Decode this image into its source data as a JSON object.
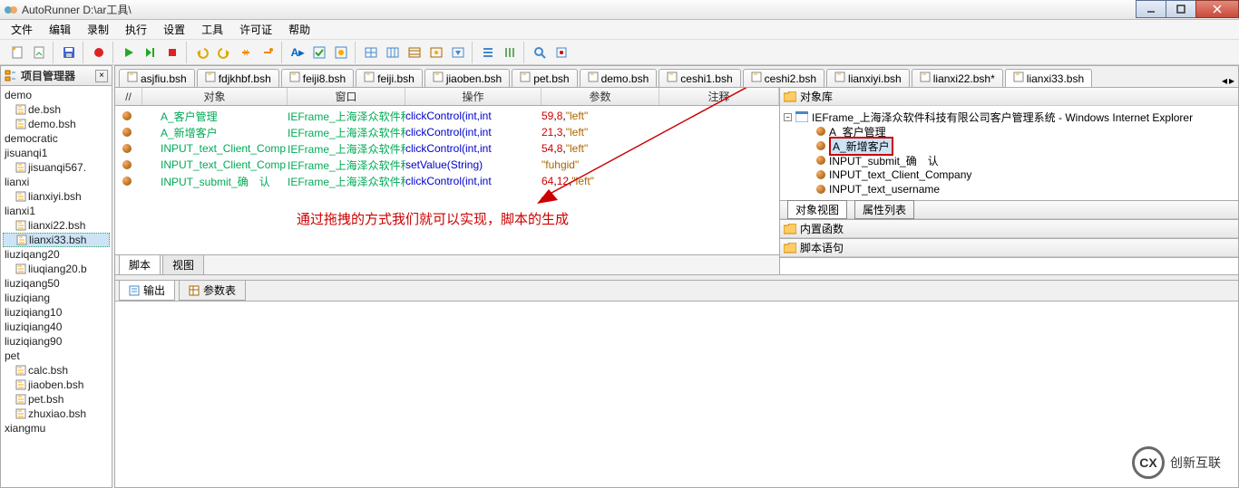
{
  "title": "AutoRunner  D:\\ar工具\\",
  "menu": [
    "文件",
    "编辑",
    "录制",
    "执行",
    "设置",
    "工具",
    "许可证",
    "帮助"
  ],
  "left_panel": {
    "title": "项目管理器",
    "items": [
      {
        "label": "demo",
        "indent": false,
        "icon": false
      },
      {
        "label": "de.bsh",
        "indent": true,
        "icon": true
      },
      {
        "label": "demo.bsh",
        "indent": true,
        "icon": true
      },
      {
        "label": "democratic",
        "indent": false,
        "icon": false
      },
      {
        "label": "jisuanqi1",
        "indent": false,
        "icon": false
      },
      {
        "label": "jisuanqi567.",
        "indent": true,
        "icon": true
      },
      {
        "label": "lianxi",
        "indent": false,
        "icon": false
      },
      {
        "label": "lianxiyi.bsh",
        "indent": true,
        "icon": true
      },
      {
        "label": "lianxi1",
        "indent": false,
        "icon": false
      },
      {
        "label": "lianxi22.bsh",
        "indent": true,
        "icon": true
      },
      {
        "label": "lianxi33.bsh",
        "indent": true,
        "icon": true,
        "selected": true
      },
      {
        "label": "liuziqang20",
        "indent": false,
        "icon": false
      },
      {
        "label": "liuqiang20.b",
        "indent": true,
        "icon": true
      },
      {
        "label": "liuziqang50",
        "indent": false,
        "icon": false
      },
      {
        "label": "liuziqiang",
        "indent": false,
        "icon": false
      },
      {
        "label": "liuziqiang10",
        "indent": false,
        "icon": false
      },
      {
        "label": "liuziqiang40",
        "indent": false,
        "icon": false
      },
      {
        "label": "liuziqiang90",
        "indent": false,
        "icon": false
      },
      {
        "label": "pet",
        "indent": false,
        "icon": false
      },
      {
        "label": "calc.bsh",
        "indent": true,
        "icon": true
      },
      {
        "label": "jiaoben.bsh",
        "indent": true,
        "icon": true
      },
      {
        "label": "pet.bsh",
        "indent": true,
        "icon": true
      },
      {
        "label": "zhuxiao.bsh",
        "indent": true,
        "icon": true
      },
      {
        "label": "xiangmu",
        "indent": false,
        "icon": false
      }
    ]
  },
  "file_tabs": [
    "asjfiu.bsh",
    "fdjkhbf.bsh",
    "feiji8.bsh",
    "feiji.bsh",
    "jiaoben.bsh",
    "pet.bsh",
    "demo.bsh",
    "ceshi1.bsh",
    "ceshi2.bsh",
    "lianxiyi.bsh",
    "lianxi22.bsh*",
    "lianxi33.bsh"
  ],
  "active_tab": 11,
  "script_headers": [
    "//",
    "对象",
    "窗口",
    "操作",
    "参数",
    "注释"
  ],
  "script_rows": [
    {
      "obj": "A_客户管理",
      "win": "IEFrame_上海泽众软件科",
      "op": "clickControl(int,int",
      "param_html": "<span class='num'>59</span>,<span class='num'>8</span>,<span class='str'>\"left\"</span>"
    },
    {
      "obj": "A_新增客户",
      "win": "IEFrame_上海泽众软件科",
      "op": "clickControl(int,int",
      "param_html": "<span class='num'>21</span>,<span class='num'>3</span>,<span class='str'>\"left\"</span>"
    },
    {
      "obj": "INPUT_text_Client_Comp",
      "win": "IEFrame_上海泽众软件科",
      "op": "clickControl(int,int",
      "param_html": "<span class='num'>54</span>,<span class='num'>8</span>,<span class='str'>\"left\"</span>"
    },
    {
      "obj": "INPUT_text_Client_Comp",
      "win": "IEFrame_上海泽众软件科",
      "op": "setValue(String)",
      "param_html": "<span class='str'>\"fuhgid\"</span>"
    },
    {
      "obj": "INPUT_submit_确　认",
      "win": "IEFrame_上海泽众软件科",
      "op": "clickControl(int,int",
      "param_html": "<span class='num'>64</span>,<span class='num'>12</span>,<span class='str'>\"left\"</span>"
    }
  ],
  "annotation_text": "通过拖拽的方式我们就可以实现，脚本的生成",
  "sub_tabs": [
    "脚本",
    "视图"
  ],
  "right_panel": {
    "obj_lib": "对象库",
    "root_node": "IEFrame_上海泽众软件科技有限公司客户管理系统 - Windows Internet Explorer",
    "children": [
      "A_客户管理",
      "A_新增客户",
      "INPUT_submit_确　认",
      "INPUT_text_Client_Company",
      "INPUT_text_username"
    ],
    "selected_child": 1,
    "view_tabs": [
      "对象视图",
      "属性列表"
    ],
    "builtin_fn": "内置函数",
    "script_stmt": "脚本语句"
  },
  "output_tabs": [
    "输出",
    "参数表"
  ],
  "watermark": "创新互联"
}
